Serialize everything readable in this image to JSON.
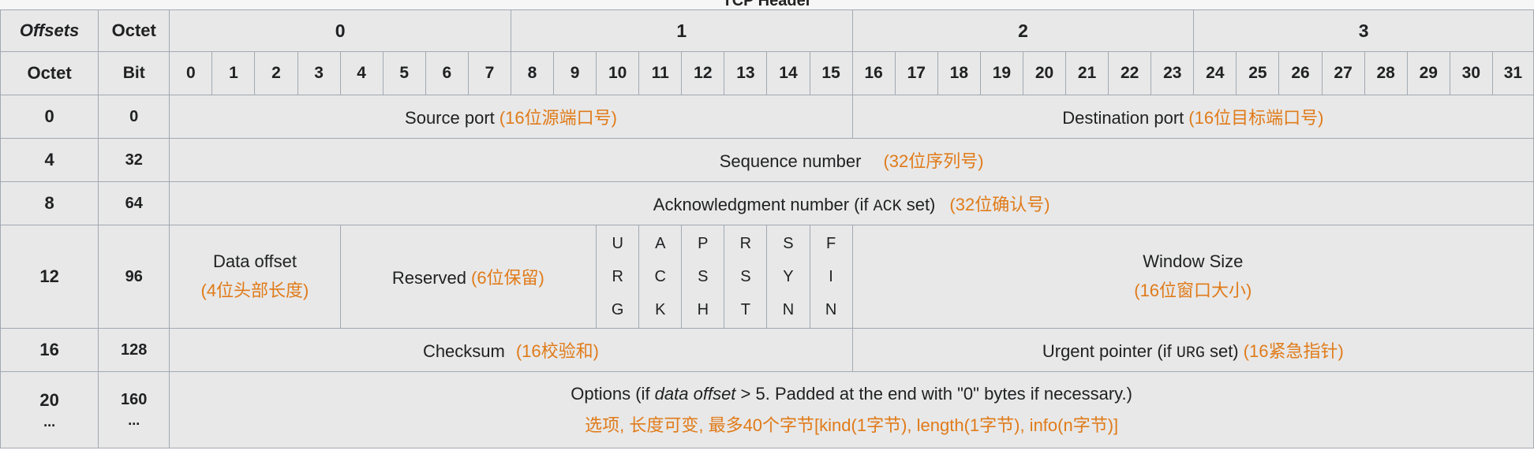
{
  "title": "TCP Header",
  "headers": {
    "offsets": "Offsets",
    "octet_top": "Octet",
    "octet_left": "Octet",
    "bit": "Bit",
    "byte_groups": [
      "0",
      "1",
      "2",
      "3"
    ],
    "bits": [
      "0",
      "1",
      "2",
      "3",
      "4",
      "5",
      "6",
      "7",
      "8",
      "9",
      "10",
      "11",
      "12",
      "13",
      "14",
      "15",
      "16",
      "17",
      "18",
      "19",
      "20",
      "21",
      "22",
      "23",
      "24",
      "25",
      "26",
      "27",
      "28",
      "29",
      "30",
      "31"
    ]
  },
  "rows": [
    {
      "octet": "0",
      "bit": "0"
    },
    {
      "octet": "4",
      "bit": "32"
    },
    {
      "octet": "8",
      "bit": "64"
    },
    {
      "octet": "12",
      "bit": "96"
    },
    {
      "octet": "16",
      "bit": "128"
    },
    {
      "octet": "20",
      "octet_more": "...",
      "bit": "160",
      "bit_more": "..."
    }
  ],
  "fields": {
    "source_port": {
      "label": "Source port",
      "cn": "(16位源端口号)"
    },
    "destination_port": {
      "label": "Destination port",
      "cn": "(16位目标端口号)"
    },
    "sequence_number": {
      "label": "Sequence number",
      "cn": "(32位序列号)"
    },
    "ack_number": {
      "label_pre": "Acknowledgment number (if ",
      "code": "ACK",
      "label_post": " set)",
      "cn": "(32位确认号)"
    },
    "data_offset": {
      "label": "Data offset",
      "cn": "(4位头部长度)"
    },
    "reserved": {
      "label": "Reserved",
      "cn": "(6位保留)"
    },
    "flags": [
      {
        "l1": "U",
        "l2": "R",
        "l3": "G"
      },
      {
        "l1": "A",
        "l2": "C",
        "l3": "K"
      },
      {
        "l1": "P",
        "l2": "S",
        "l3": "H"
      },
      {
        "l1": "R",
        "l2": "S",
        "l3": "T"
      },
      {
        "l1": "S",
        "l2": "Y",
        "l3": "N"
      },
      {
        "l1": "F",
        "l2": "I",
        "l3": "N"
      }
    ],
    "window_size": {
      "label": "Window Size",
      "cn": "(16位窗口大小)"
    },
    "checksum": {
      "label": "Checksum",
      "cn": "(16校验和)"
    },
    "urgent_pointer": {
      "label_pre": "Urgent pointer (if ",
      "code": "URG",
      "label_post": " set)",
      "cn": "(16紧急指针)"
    },
    "options": {
      "pre": "Options (if ",
      "italic": "data offset",
      "post": " > 5. Padded at the end with \"0\" bytes if necessary.)",
      "cn": "选项, 长度可变, 最多40个字节[kind(1字节), length(1字节), info(n字节)]"
    }
  },
  "colors": {
    "cell_bg": "#e8e8e8",
    "header_bg": "#eaecf0",
    "options_bg": "#c8a2a2",
    "accent_blue": "#3366cc",
    "cn_orange": "#e07b1a",
    "border": "#a2a9b1"
  }
}
